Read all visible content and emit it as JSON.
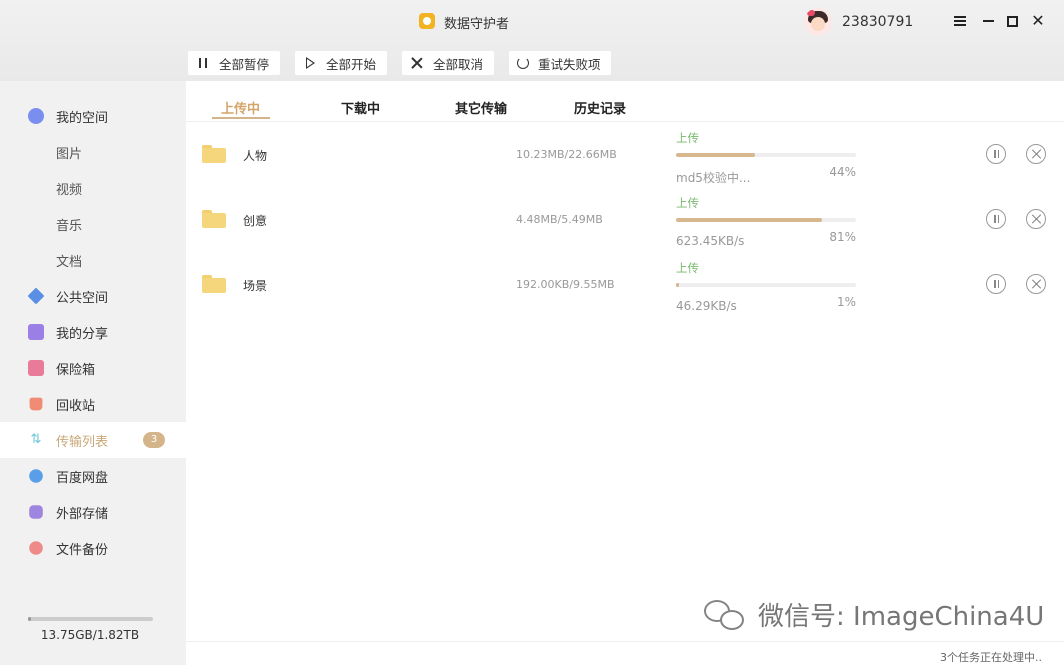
{
  "app": {
    "title": "数据守护者",
    "user_id": "23830791"
  },
  "toolbar": {
    "pause_all": "全部暂停",
    "start_all": "全部开始",
    "cancel_all": "全部取消",
    "retry_failed": "重试失败项"
  },
  "sidebar": {
    "items": [
      {
        "label": "我的空间",
        "icon": "my-space-icon",
        "color": "#7a8ef0"
      },
      {
        "label": "图片"
      },
      {
        "label": "视频"
      },
      {
        "label": "音乐"
      },
      {
        "label": "文档"
      },
      {
        "label": "公共空间",
        "icon": "paper-plane-icon",
        "color": "#5b8fe6"
      },
      {
        "label": "我的分享",
        "icon": "share-icon",
        "color": "#9b7fe6"
      },
      {
        "label": "保险箱",
        "icon": "safe-icon",
        "color": "#e97a9a"
      },
      {
        "label": "回收站",
        "icon": "trash-icon",
        "color": "#f08c74"
      },
      {
        "label": "传输列表",
        "icon": "transfer-icon",
        "color": "#6cc4d8",
        "badge": "3"
      },
      {
        "label": "百度网盘",
        "icon": "cloud-icon",
        "color": "#5a9ee8"
      },
      {
        "label": "外部存储",
        "icon": "usb-icon",
        "color": "#9e86e0"
      },
      {
        "label": "文件备份",
        "icon": "backup-icon",
        "color": "#ef8a8a"
      }
    ],
    "storage_text": "13.75GB/1.82TB",
    "storage_used_fraction": 0.0074
  },
  "tabs": [
    {
      "label": "上传中"
    },
    {
      "label": "下载中"
    },
    {
      "label": "其它传输"
    },
    {
      "label": "历史记录"
    }
  ],
  "transfers": [
    {
      "name": "人物",
      "size": "10.23MB/22.66MB",
      "status": "上传",
      "progress": 44,
      "percent_text": "44%",
      "detail": "md5校验中..."
    },
    {
      "name": "创意",
      "size": "4.48MB/5.49MB",
      "status": "上传",
      "progress": 81,
      "percent_text": "81%",
      "detail": "623.45KB/s"
    },
    {
      "name": "场景",
      "size": "192.00KB/9.55MB",
      "status": "上传",
      "progress": 1,
      "percent_text": "1%",
      "detail": "46.29KB/s"
    }
  ],
  "watermark": "微信号: ImageChina4U",
  "footer": {
    "status": "3个任务正在处理中.."
  }
}
